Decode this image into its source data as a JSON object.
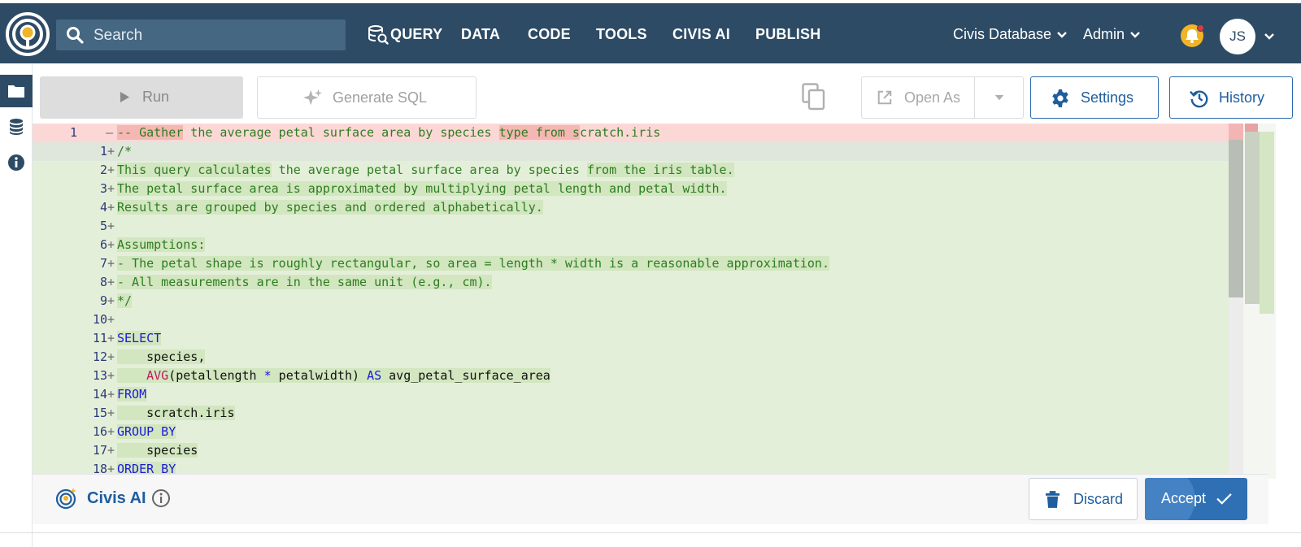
{
  "header": {
    "search_placeholder": "Search",
    "nav": [
      {
        "label": "QUERY",
        "icon": "database-search-icon"
      },
      {
        "label": "DATA"
      },
      {
        "label": "CODE"
      },
      {
        "label": "TOOLS"
      },
      {
        "label": "CIVIS AI"
      },
      {
        "label": "PUBLISH"
      }
    ],
    "database_selector": "Civis Database",
    "role_selector": "Admin",
    "avatar_initials": "JS",
    "colors": {
      "bar": "#2d4b65",
      "search": "#466782",
      "bell": "#f0b429"
    }
  },
  "sidebar": {
    "items": [
      {
        "icon": "folder-icon",
        "active": true
      },
      {
        "icon": "database-icon",
        "active": false
      },
      {
        "icon": "info-icon",
        "active": false
      }
    ]
  },
  "toolbar": {
    "run_label": "Run",
    "generate_sql_label": "Generate SQL",
    "open_as_label": "Open As",
    "settings_label": "Settings",
    "history_label": "History"
  },
  "editor": {
    "removed_line": {
      "old_number": "1",
      "mark": "—",
      "segments": [
        {
          "t": "-- Gather",
          "cls": "c-comment hl-del"
        },
        {
          "t": " the average petal surface area by species ",
          "cls": "c-comment"
        },
        {
          "t": "type from s",
          "cls": "c-comment hl-del"
        },
        {
          "t": "cratch.iris",
          "cls": "c-comment"
        }
      ]
    },
    "added_lines": [
      {
        "n": "1",
        "segments": [
          {
            "t": "/*",
            "cls": "c-comment"
          }
        ]
      },
      {
        "n": "2",
        "segments": [
          {
            "t": "This query calculates",
            "cls": "c-comment hl-add"
          },
          {
            "t": " the average petal surface area by species ",
            "cls": "c-comment"
          },
          {
            "t": "from the iris table.",
            "cls": "c-comment hl-add"
          }
        ]
      },
      {
        "n": "3",
        "segments": [
          {
            "t": "The petal surface area is approximated by multiplying petal length and petal width.",
            "cls": "c-comment hl-add"
          }
        ]
      },
      {
        "n": "4",
        "segments": [
          {
            "t": "Results are grouped by species and ordered alphabetically.",
            "cls": "c-comment hl-add"
          }
        ]
      },
      {
        "n": "5",
        "segments": []
      },
      {
        "n": "6",
        "segments": [
          {
            "t": "Assumptions:",
            "cls": "c-comment hl-add"
          }
        ]
      },
      {
        "n": "7",
        "segments": [
          {
            "t": "- The petal shape is roughly rectangular, so area = length * width is a reasonable approximation.",
            "cls": "c-comment hl-add"
          }
        ]
      },
      {
        "n": "8",
        "segments": [
          {
            "t": "- All measurements are in the same unit (e.g., cm).",
            "cls": "c-comment hl-add"
          }
        ]
      },
      {
        "n": "9",
        "segments": [
          {
            "t": "*/",
            "cls": "c-comment hl-add"
          }
        ]
      },
      {
        "n": "10",
        "segments": []
      },
      {
        "n": "11",
        "segments": [
          {
            "t": "SELECT",
            "cls": "c-keyword hl-add"
          }
        ]
      },
      {
        "n": "12",
        "segments": [
          {
            "t": "    species,",
            "cls": "c-plain hl-add"
          }
        ]
      },
      {
        "n": "13",
        "segments": [
          {
            "t": "    ",
            "cls": "c-plain hl-add"
          },
          {
            "t": "AVG",
            "cls": "c-func hl-add"
          },
          {
            "t": "(petallength ",
            "cls": "c-plain hl-add"
          },
          {
            "t": "*",
            "cls": "c-keyword hl-add"
          },
          {
            "t": " petalwidth) ",
            "cls": "c-plain hl-add"
          },
          {
            "t": "AS",
            "cls": "c-keyword hl-add"
          },
          {
            "t": " avg_petal_surface_area",
            "cls": "c-plain hl-add"
          }
        ]
      },
      {
        "n": "14",
        "segments": [
          {
            "t": "FROM",
            "cls": "c-keyword hl-add"
          }
        ]
      },
      {
        "n": "15",
        "segments": [
          {
            "t": "    scratch.iris",
            "cls": "c-plain hl-add"
          }
        ]
      },
      {
        "n": "16",
        "segments": [
          {
            "t": "GROUP BY",
            "cls": "c-keyword hl-add"
          }
        ]
      },
      {
        "n": "17",
        "segments": [
          {
            "t": "    species",
            "cls": "c-plain hl-add"
          }
        ]
      },
      {
        "n": "18",
        "segments": [
          {
            "t": "ORDER BY",
            "cls": "c-keyword hl-add"
          }
        ]
      }
    ],
    "added_mark": "+"
  },
  "ai_bar": {
    "title": "Civis AI",
    "discard_label": "Discard",
    "accept_label": "Accept"
  }
}
